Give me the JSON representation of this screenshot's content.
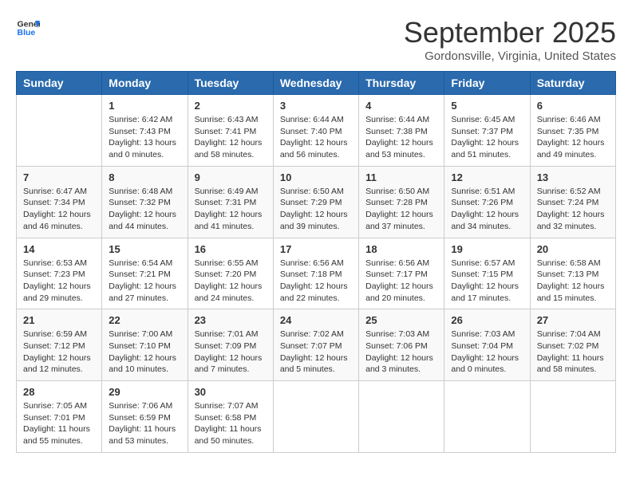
{
  "header": {
    "logo_line1": "General",
    "logo_line2": "Blue",
    "month": "September 2025",
    "location": "Gordonsville, Virginia, United States"
  },
  "weekdays": [
    "Sunday",
    "Monday",
    "Tuesday",
    "Wednesday",
    "Thursday",
    "Friday",
    "Saturday"
  ],
  "weeks": [
    [
      {
        "day": "",
        "sunrise": "",
        "sunset": "",
        "daylight": ""
      },
      {
        "day": "1",
        "sunrise": "Sunrise: 6:42 AM",
        "sunset": "Sunset: 7:43 PM",
        "daylight": "Daylight: 13 hours and 0 minutes."
      },
      {
        "day": "2",
        "sunrise": "Sunrise: 6:43 AM",
        "sunset": "Sunset: 7:41 PM",
        "daylight": "Daylight: 12 hours and 58 minutes."
      },
      {
        "day": "3",
        "sunrise": "Sunrise: 6:44 AM",
        "sunset": "Sunset: 7:40 PM",
        "daylight": "Daylight: 12 hours and 56 minutes."
      },
      {
        "day": "4",
        "sunrise": "Sunrise: 6:44 AM",
        "sunset": "Sunset: 7:38 PM",
        "daylight": "Daylight: 12 hours and 53 minutes."
      },
      {
        "day": "5",
        "sunrise": "Sunrise: 6:45 AM",
        "sunset": "Sunset: 7:37 PM",
        "daylight": "Daylight: 12 hours and 51 minutes."
      },
      {
        "day": "6",
        "sunrise": "Sunrise: 6:46 AM",
        "sunset": "Sunset: 7:35 PM",
        "daylight": "Daylight: 12 hours and 49 minutes."
      }
    ],
    [
      {
        "day": "7",
        "sunrise": "Sunrise: 6:47 AM",
        "sunset": "Sunset: 7:34 PM",
        "daylight": "Daylight: 12 hours and 46 minutes."
      },
      {
        "day": "8",
        "sunrise": "Sunrise: 6:48 AM",
        "sunset": "Sunset: 7:32 PM",
        "daylight": "Daylight: 12 hours and 44 minutes."
      },
      {
        "day": "9",
        "sunrise": "Sunrise: 6:49 AM",
        "sunset": "Sunset: 7:31 PM",
        "daylight": "Daylight: 12 hours and 41 minutes."
      },
      {
        "day": "10",
        "sunrise": "Sunrise: 6:50 AM",
        "sunset": "Sunset: 7:29 PM",
        "daylight": "Daylight: 12 hours and 39 minutes."
      },
      {
        "day": "11",
        "sunrise": "Sunrise: 6:50 AM",
        "sunset": "Sunset: 7:28 PM",
        "daylight": "Daylight: 12 hours and 37 minutes."
      },
      {
        "day": "12",
        "sunrise": "Sunrise: 6:51 AM",
        "sunset": "Sunset: 7:26 PM",
        "daylight": "Daylight: 12 hours and 34 minutes."
      },
      {
        "day": "13",
        "sunrise": "Sunrise: 6:52 AM",
        "sunset": "Sunset: 7:24 PM",
        "daylight": "Daylight: 12 hours and 32 minutes."
      }
    ],
    [
      {
        "day": "14",
        "sunrise": "Sunrise: 6:53 AM",
        "sunset": "Sunset: 7:23 PM",
        "daylight": "Daylight: 12 hours and 29 minutes."
      },
      {
        "day": "15",
        "sunrise": "Sunrise: 6:54 AM",
        "sunset": "Sunset: 7:21 PM",
        "daylight": "Daylight: 12 hours and 27 minutes."
      },
      {
        "day": "16",
        "sunrise": "Sunrise: 6:55 AM",
        "sunset": "Sunset: 7:20 PM",
        "daylight": "Daylight: 12 hours and 24 minutes."
      },
      {
        "day": "17",
        "sunrise": "Sunrise: 6:56 AM",
        "sunset": "Sunset: 7:18 PM",
        "daylight": "Daylight: 12 hours and 22 minutes."
      },
      {
        "day": "18",
        "sunrise": "Sunrise: 6:56 AM",
        "sunset": "Sunset: 7:17 PM",
        "daylight": "Daylight: 12 hours and 20 minutes."
      },
      {
        "day": "19",
        "sunrise": "Sunrise: 6:57 AM",
        "sunset": "Sunset: 7:15 PM",
        "daylight": "Daylight: 12 hours and 17 minutes."
      },
      {
        "day": "20",
        "sunrise": "Sunrise: 6:58 AM",
        "sunset": "Sunset: 7:13 PM",
        "daylight": "Daylight: 12 hours and 15 minutes."
      }
    ],
    [
      {
        "day": "21",
        "sunrise": "Sunrise: 6:59 AM",
        "sunset": "Sunset: 7:12 PM",
        "daylight": "Daylight: 12 hours and 12 minutes."
      },
      {
        "day": "22",
        "sunrise": "Sunrise: 7:00 AM",
        "sunset": "Sunset: 7:10 PM",
        "daylight": "Daylight: 12 hours and 10 minutes."
      },
      {
        "day": "23",
        "sunrise": "Sunrise: 7:01 AM",
        "sunset": "Sunset: 7:09 PM",
        "daylight": "Daylight: 12 hours and 7 minutes."
      },
      {
        "day": "24",
        "sunrise": "Sunrise: 7:02 AM",
        "sunset": "Sunset: 7:07 PM",
        "daylight": "Daylight: 12 hours and 5 minutes."
      },
      {
        "day": "25",
        "sunrise": "Sunrise: 7:03 AM",
        "sunset": "Sunset: 7:06 PM",
        "daylight": "Daylight: 12 hours and 3 minutes."
      },
      {
        "day": "26",
        "sunrise": "Sunrise: 7:03 AM",
        "sunset": "Sunset: 7:04 PM",
        "daylight": "Daylight: 12 hours and 0 minutes."
      },
      {
        "day": "27",
        "sunrise": "Sunrise: 7:04 AM",
        "sunset": "Sunset: 7:02 PM",
        "daylight": "Daylight: 11 hours and 58 minutes."
      }
    ],
    [
      {
        "day": "28",
        "sunrise": "Sunrise: 7:05 AM",
        "sunset": "Sunset: 7:01 PM",
        "daylight": "Daylight: 11 hours and 55 minutes."
      },
      {
        "day": "29",
        "sunrise": "Sunrise: 7:06 AM",
        "sunset": "Sunset: 6:59 PM",
        "daylight": "Daylight: 11 hours and 53 minutes."
      },
      {
        "day": "30",
        "sunrise": "Sunrise: 7:07 AM",
        "sunset": "Sunset: 6:58 PM",
        "daylight": "Daylight: 11 hours and 50 minutes."
      },
      {
        "day": "",
        "sunrise": "",
        "sunset": "",
        "daylight": ""
      },
      {
        "day": "",
        "sunrise": "",
        "sunset": "",
        "daylight": ""
      },
      {
        "day": "",
        "sunrise": "",
        "sunset": "",
        "daylight": ""
      },
      {
        "day": "",
        "sunrise": "",
        "sunset": "",
        "daylight": ""
      }
    ]
  ]
}
